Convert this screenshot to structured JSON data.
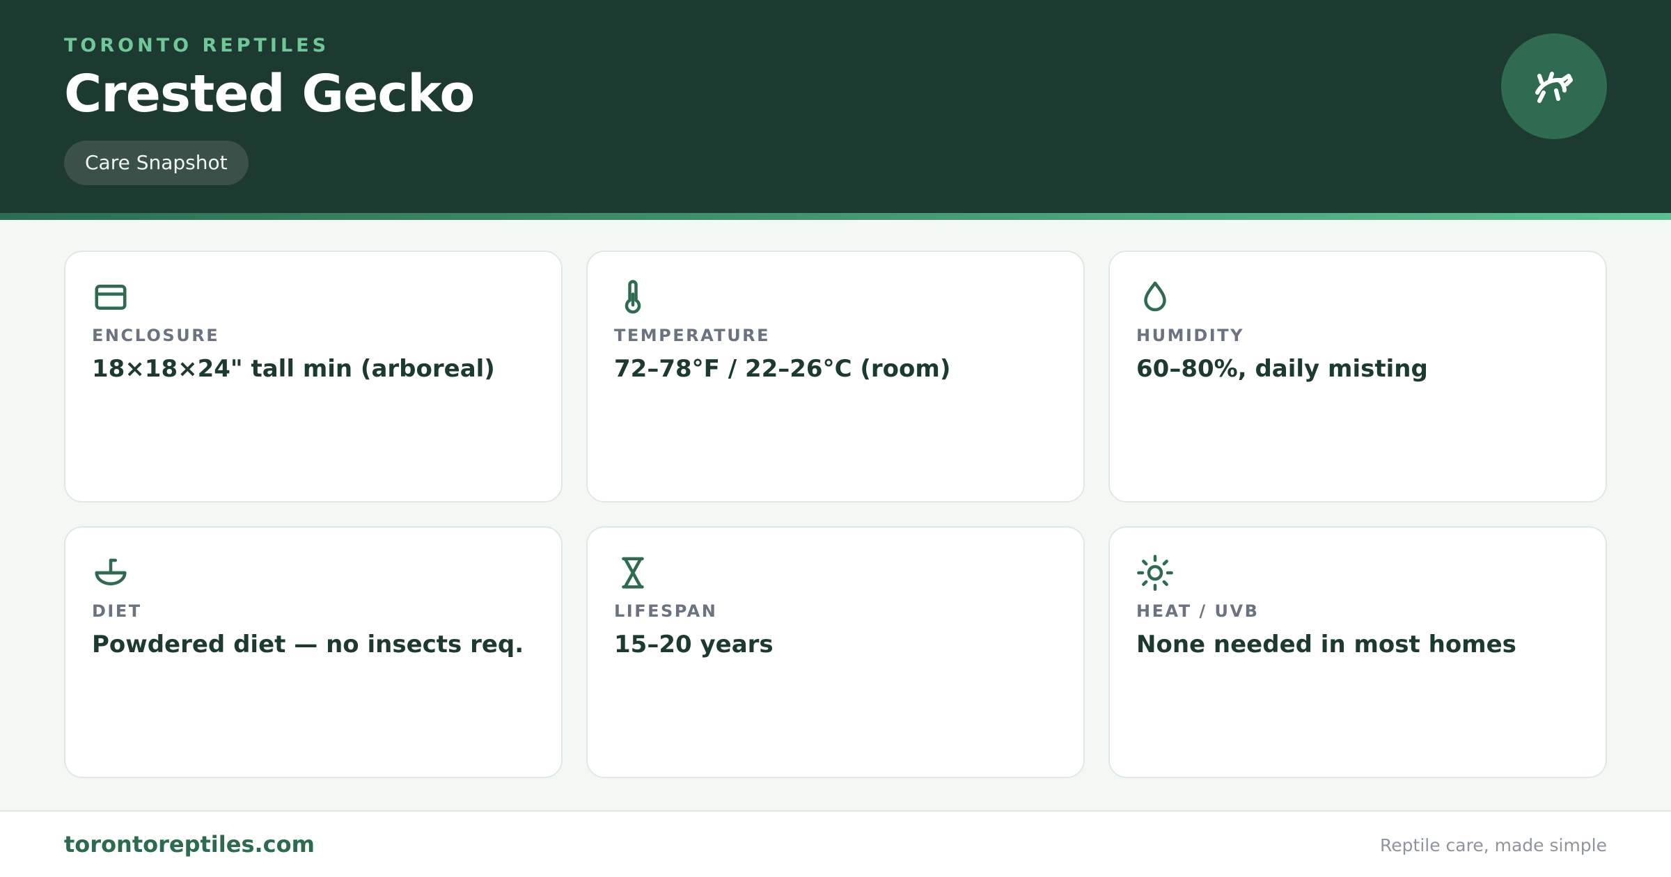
{
  "header": {
    "brand": "TORONTO REPTILES",
    "title": "Crested Gecko",
    "badge": "Care Snapshot",
    "logo_icon": "gecko-icon"
  },
  "cards": [
    {
      "icon": "enclosure-icon",
      "label": "ENCLOSURE",
      "value": "18×18×24\" tall min (arboreal)"
    },
    {
      "icon": "thermometer-icon",
      "label": "TEMPERATURE",
      "value": "72–78°F / 22–26°C (room)"
    },
    {
      "icon": "droplet-icon",
      "label": "HUMIDITY",
      "value": "60–80%, daily misting"
    },
    {
      "icon": "bowl-icon",
      "label": "DIET",
      "value": "Powdered diet — no insects req."
    },
    {
      "icon": "hourglass-icon",
      "label": "LIFESPAN",
      "value": "15–20 years"
    },
    {
      "icon": "sun-icon",
      "label": "HEAT / UVB",
      "value": "None needed in most homes"
    }
  ],
  "footer": {
    "site": "torontoreptiles.com",
    "tagline": "Reptile care, made simple"
  },
  "colors": {
    "header_bg": "#1c3a30",
    "accent": "#2e6b50",
    "accent_light": "#6fc79a",
    "page_bg": "#f3f8f5"
  }
}
